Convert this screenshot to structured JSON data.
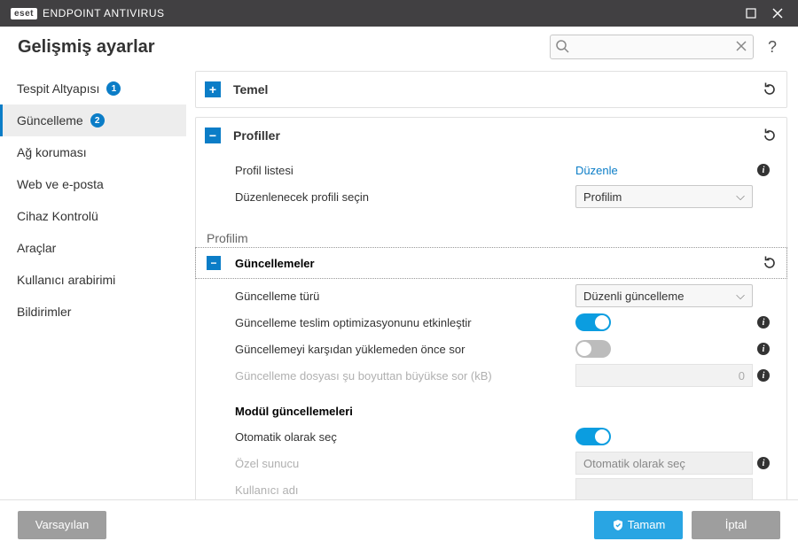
{
  "titlebar": {
    "brand_box": "eset",
    "brand_name": "ENDPOINT ANTIVIRUS"
  },
  "header": {
    "title": "Gelişmiş ayarlar",
    "search_placeholder": "",
    "help": "?"
  },
  "sidebar": {
    "items": [
      {
        "label": "Tespit Altyapısı",
        "badge": "1"
      },
      {
        "label": "Güncelleme",
        "badge": "2"
      },
      {
        "label": "Ağ koruması"
      },
      {
        "label": "Web ve e-posta"
      },
      {
        "label": "Cihaz Kontrolü"
      },
      {
        "label": "Araçlar"
      },
      {
        "label": "Kullanıcı arabirimi"
      },
      {
        "label": "Bildirimler"
      }
    ]
  },
  "sections": {
    "temel": {
      "title": "Temel"
    },
    "profiller": {
      "title": "Profiller",
      "row1_label": "Profil listesi",
      "row1_link": "Düzenle",
      "row2_label": "Düzenlenecek profili seçin",
      "row2_value": "Profilim"
    },
    "profilim_caption": "Profilim",
    "guncellemeler": {
      "title": "Güncellemeler",
      "r1_label": "Güncelleme türü",
      "r1_value": "Düzenli güncelleme",
      "r2_label": "Güncelleme teslim optimizasyonunu etkinleştir",
      "r3_label": "Güncellemeyi karşıdan yüklemeden önce sor",
      "r4_label": "Güncelleme dosyası şu boyuttan büyükse sor (kB)",
      "r4_value": "0",
      "modul_title": "Modül güncellemeleri",
      "m1_label": "Otomatik olarak seç",
      "m2_label": "Özel sunucu",
      "m2_value": "Otomatik olarak seç",
      "m3_label": "Kullanıcı adı"
    }
  },
  "footer": {
    "defaults": "Varsayılan",
    "ok": "Tamam",
    "cancel": "İptal"
  }
}
